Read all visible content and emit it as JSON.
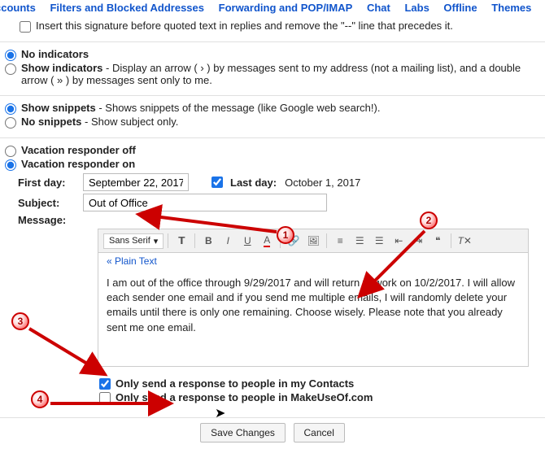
{
  "tabs": [
    "ccounts",
    "Filters and Blocked Addresses",
    "Forwarding and POP/IMAP",
    "Chat",
    "Labs",
    "Offline",
    "Themes"
  ],
  "signature": {
    "insert_before_quoted": "Insert this signature before quoted text in replies and remove the \"--\" line that precedes it."
  },
  "indicators": {
    "no_label": "No indicators",
    "show_label": "Show indicators",
    "show_desc": " - Display an arrow ( › ) by messages sent to my address (not a mailing list), and a double arrow ( » ) by messages sent only to me."
  },
  "snippets": {
    "show_label": "Show snippets",
    "show_desc": " - Shows snippets of the message (like Google web search!).",
    "no_label": "No snippets",
    "no_desc": " - Show subject only."
  },
  "vacation": {
    "off_label": "Vacation responder off",
    "on_label": "Vacation responder on",
    "first_day_label": "First day:",
    "first_day_value": "September 22, 2017",
    "last_day_label": "Last day:",
    "last_day_value": "October 1, 2017",
    "subject_label": "Subject:",
    "subject_value": "Out of Office",
    "message_label": "Message:",
    "font_name": "Sans Serif",
    "plain_text": "« Plain Text",
    "body": "I am out of the office through 9/29/2017 and will return to work on 10/2/2017. I will allow each sender one email and if you send me multiple emails, I will randomly delete your emails until there is only one remaining. Choose wisely. Please note that you already sent me one email.",
    "only_contacts": "Only send a response to people in my Contacts",
    "only_domain": "Only send a response to people in MakeUseOf.com"
  },
  "buttons": {
    "save": "Save Changes",
    "cancel": "Cancel"
  },
  "markers": {
    "m1": "1",
    "m2": "2",
    "m3": "3",
    "m4": "4"
  }
}
